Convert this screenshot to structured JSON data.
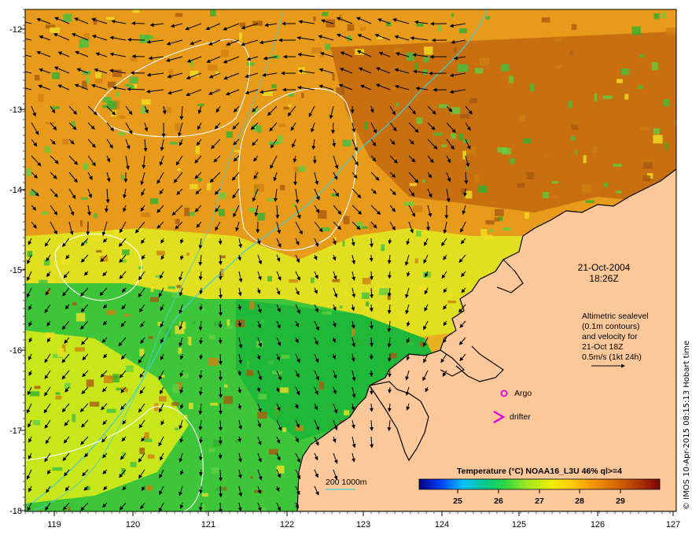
{
  "map": {
    "date": "21-Oct-2004",
    "time": "18:26Z",
    "longitude_ticks": [
      "119",
      "120",
      "121",
      "122",
      "123",
      "124",
      "125",
      "126",
      "127"
    ],
    "latitude_ticks": [
      "-12",
      "-13",
      "-14",
      "-15",
      "-16",
      "-17",
      "-18"
    ],
    "credit": "© IMOS 10-Apr-2015 08:15:13 Hobart time"
  },
  "altimetry_note": {
    "lines": [
      "Altimetric sealevel",
      "(0.1m contours)",
      "and velocity for",
      "21-Oct 18Z",
      "0.5m/s (1kt 24h)"
    ]
  },
  "legend": {
    "argo_label": "Argo",
    "drifter_label": "drifter",
    "argo_symbol": "o",
    "drifter_symbol": ">",
    "isobath_label": "200  1000m",
    "argo_color": "#e000e0",
    "isobath_color": "#40d0d0"
  },
  "colorbar": {
    "title": "Temperature (°C) NOAA16_L3U 46% ql>=4",
    "tick_labels": [
      "25",
      "26",
      "27",
      "28",
      "29"
    ],
    "stops": [
      "#00007f",
      "#0040ff",
      "#00c0ff",
      "#00d080",
      "#40e040",
      "#c0f020",
      "#f0f000",
      "#ffc000",
      "#f09000",
      "#d06000",
      "#a03000",
      "#800000"
    ]
  },
  "colors": {
    "land": "#fcc89a",
    "water_warm": "#e89a1a",
    "water_cool": "#3ec63a",
    "water_mid": "#d7ea18",
    "coast": "#000000",
    "contour": "#ffffff"
  }
}
